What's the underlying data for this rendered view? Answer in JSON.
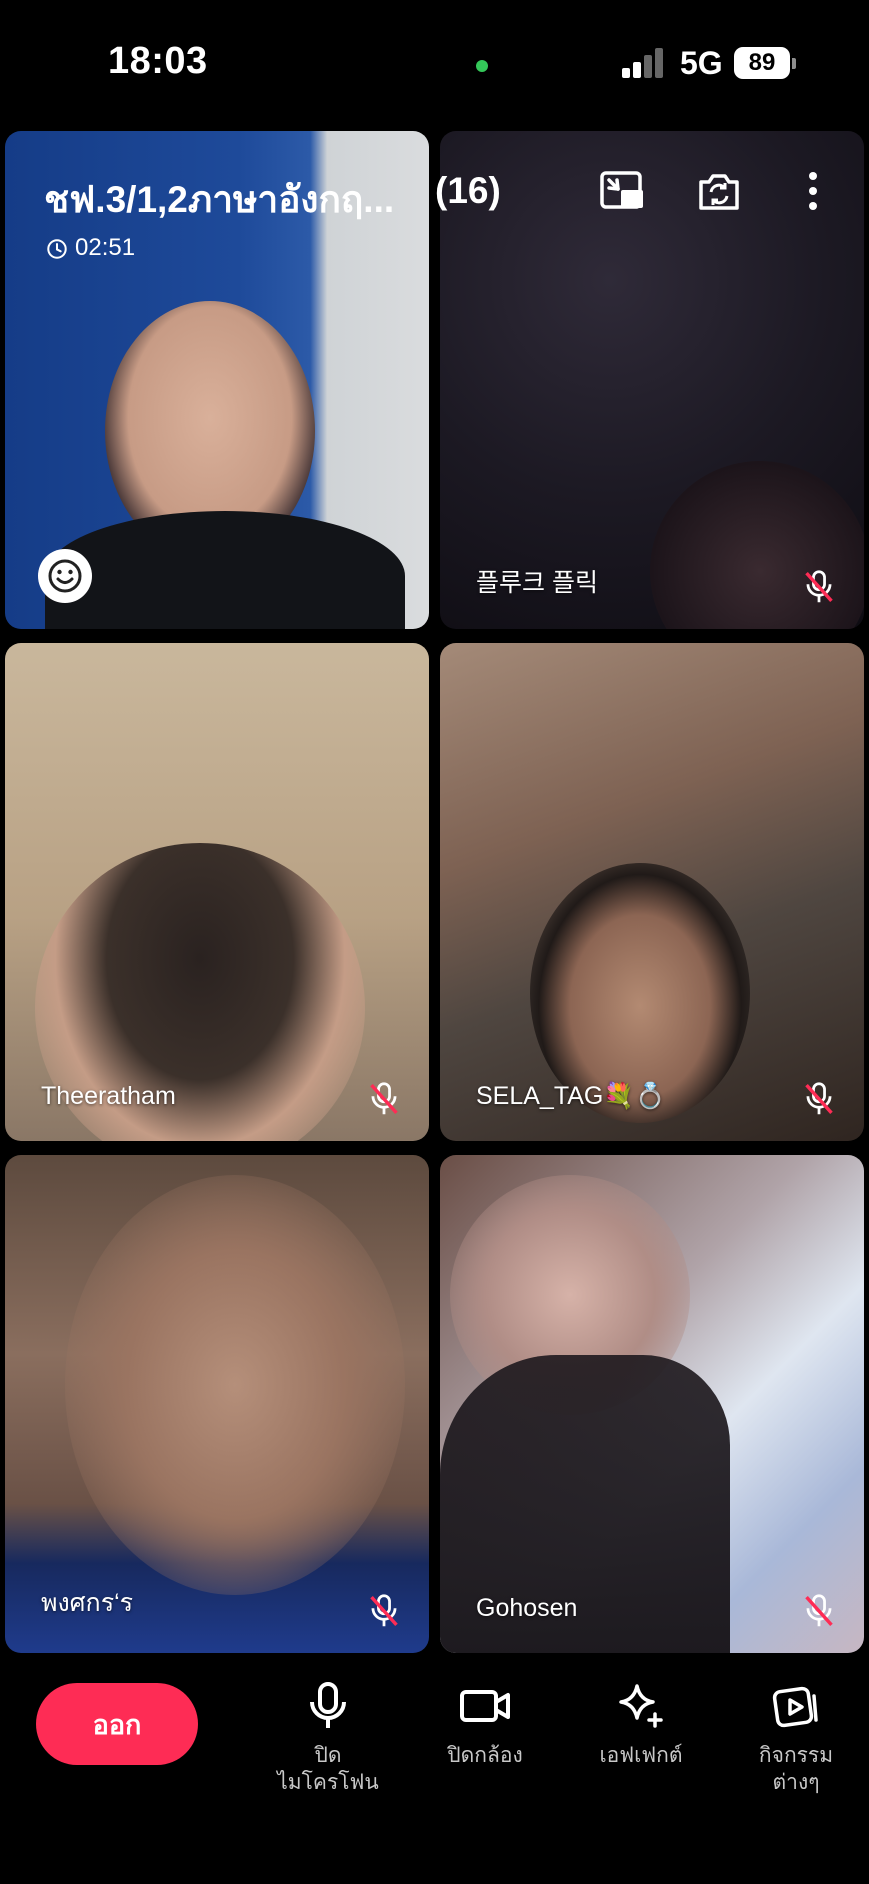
{
  "status_bar": {
    "time": "18:03",
    "network": "5G",
    "battery": "89"
  },
  "call": {
    "title": "ชฟ.3/1,2ภาษาอังกฤ...",
    "participant_count": "(16)",
    "duration": "02:51"
  },
  "participants": [
    {
      "name": ""
    },
    {
      "name": "플루크 플릭"
    },
    {
      "name": "Theeratham"
    },
    {
      "name": "SELA_TAG💐💍"
    },
    {
      "name": "พงศกร‘ร"
    },
    {
      "name": "Gohosen"
    }
  ],
  "controls": {
    "leave": "ออก",
    "mic": "ปิด\nไมโครโฟน",
    "camera": "ปิดกล้อง",
    "effects": "เอฟเฟกต์",
    "activities": "กิจกรรม\nต่างๆ"
  },
  "icons": {
    "pip": "picture-in-picture-icon",
    "flip": "flip-camera-icon",
    "more": "more-vertical-icon",
    "emoji": "smiley-icon",
    "mute": "mic-muted-icon"
  },
  "colors": {
    "leave_button": "#fe2c55",
    "background": "#000000"
  }
}
